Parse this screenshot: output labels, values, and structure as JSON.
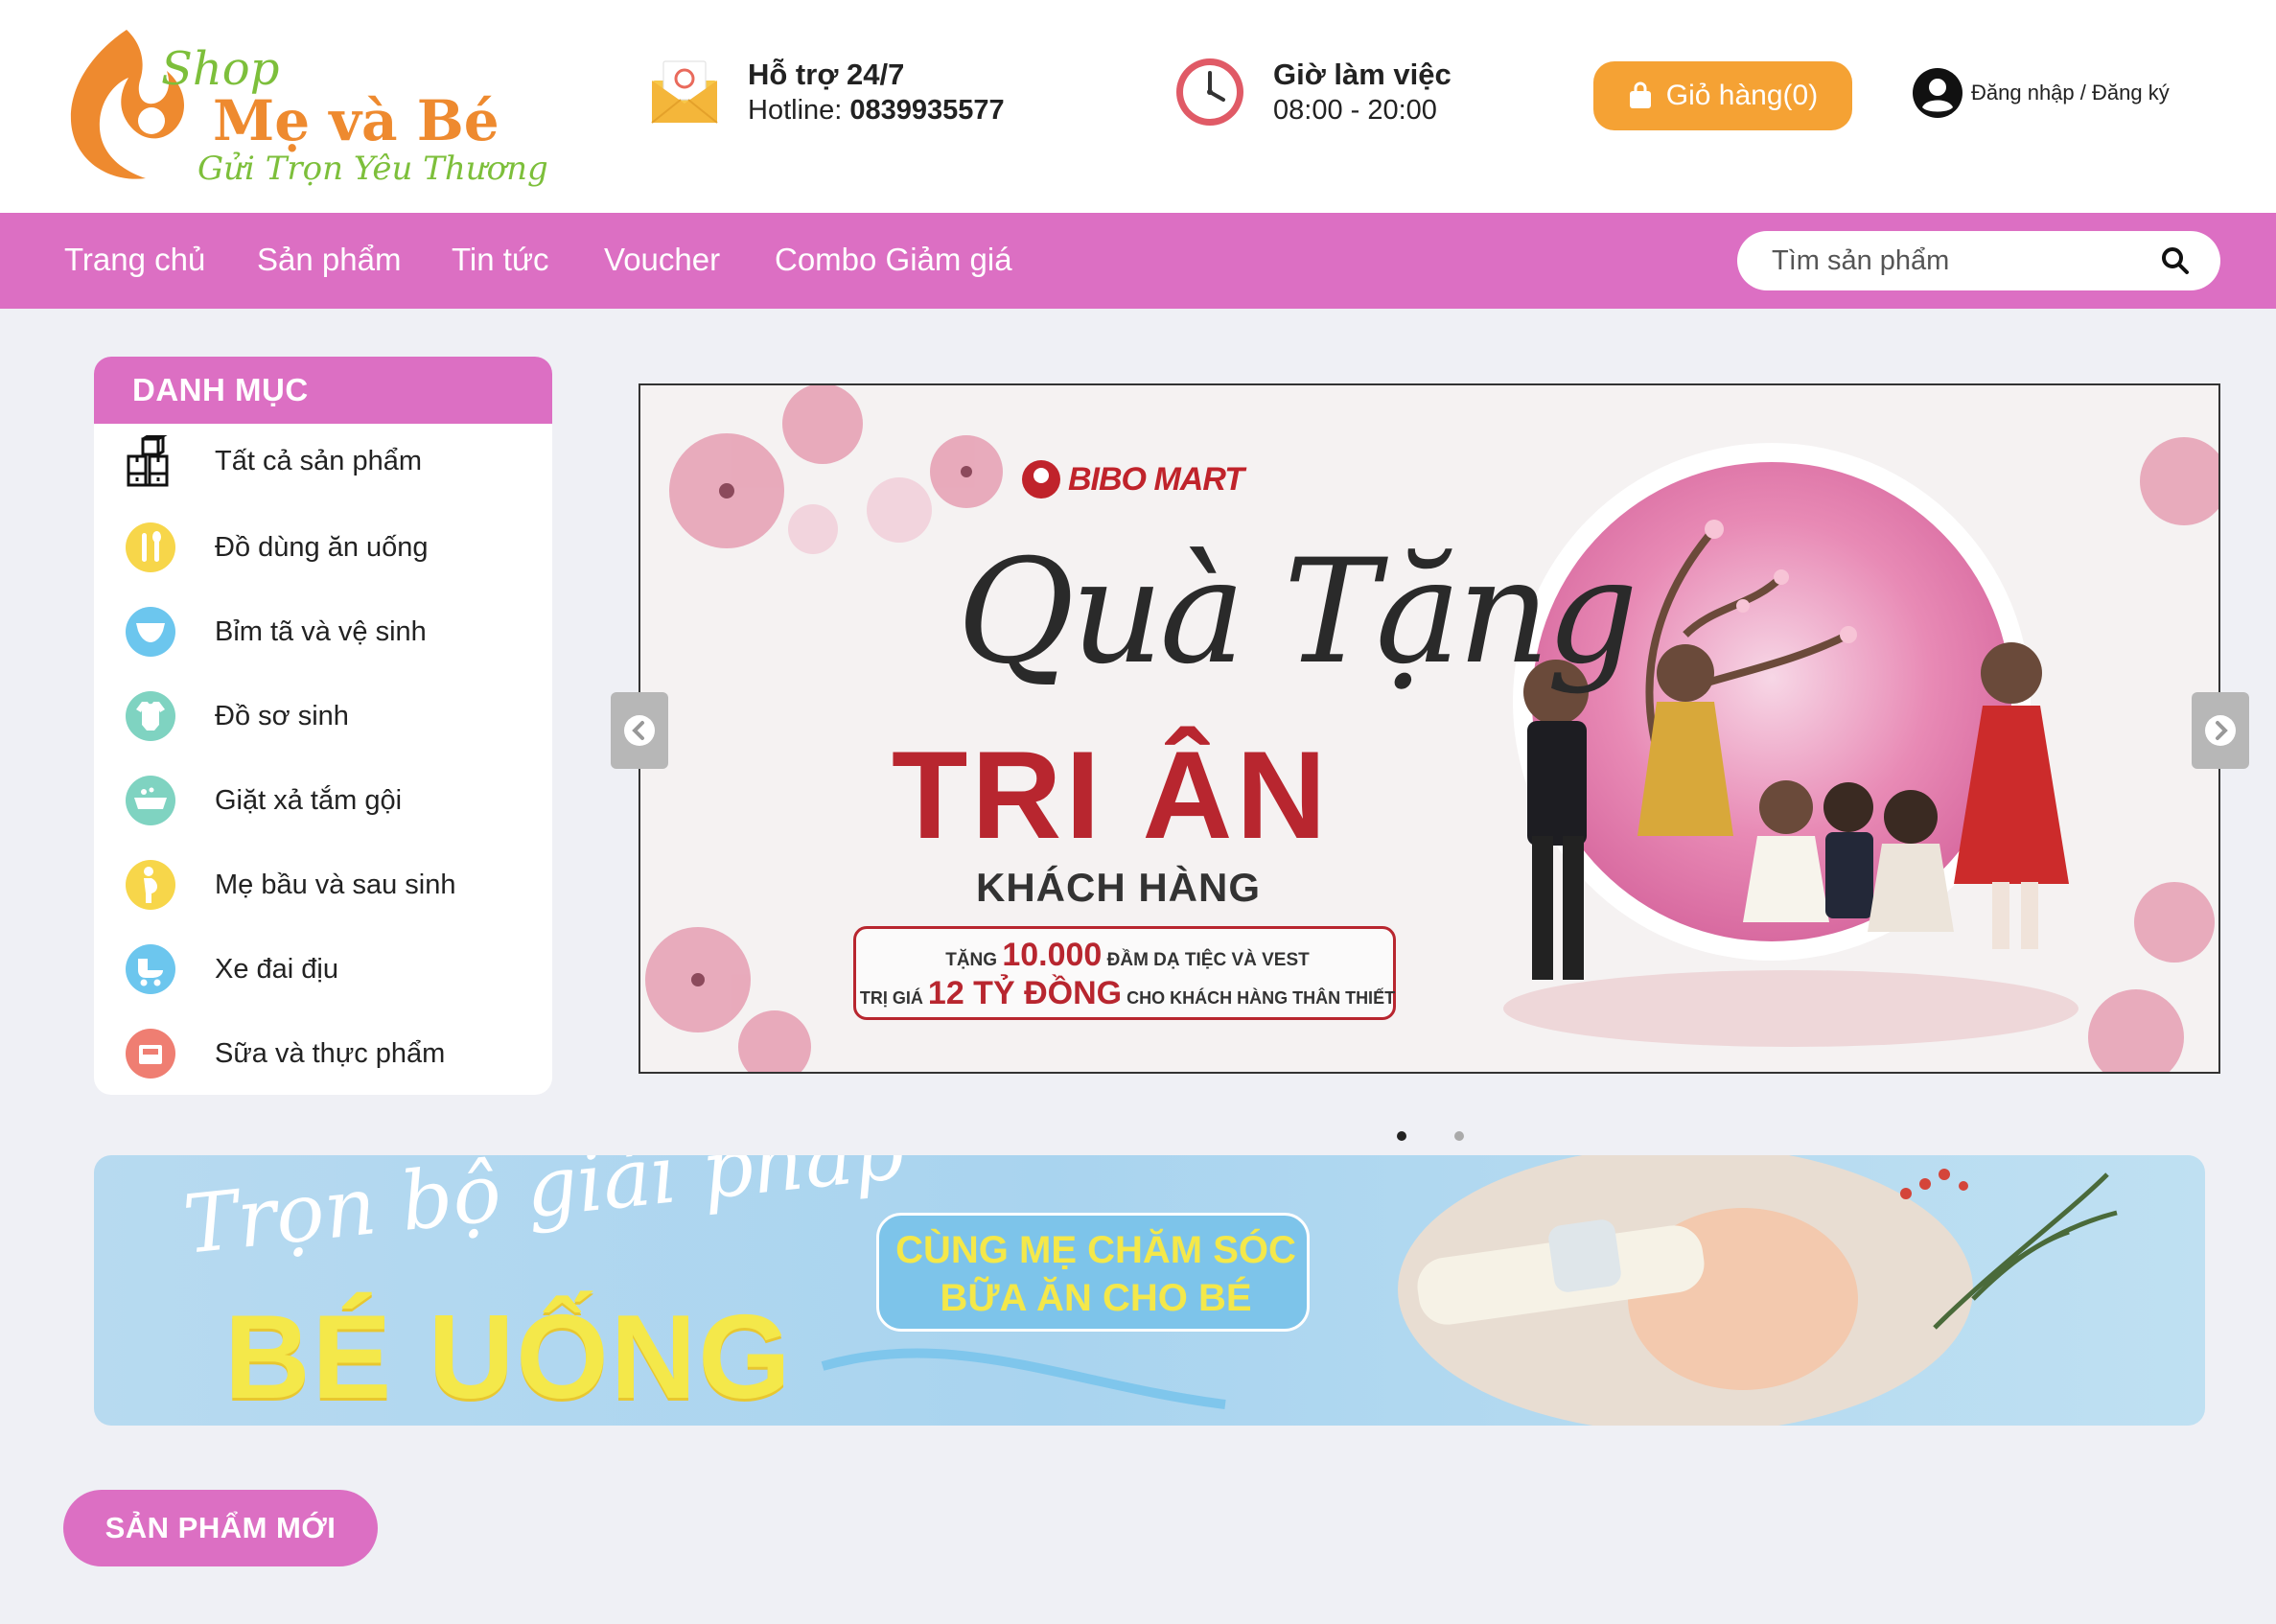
{
  "brand": {
    "shop": "Shop",
    "name": "Mẹ và Bé",
    "slogan": "Gửi Trọn Yêu Thương",
    "color_primary": "#dc6fc3",
    "color_accent": "#f5a234",
    "color_logo": "#ee8a2f"
  },
  "header": {
    "support_title": "Hỗ trợ 24/7",
    "hotline_label": "Hotline: ",
    "hotline_number": "0839935577",
    "hours_title": "Giờ làm việc",
    "hours_value": "08:00 - 20:00",
    "cart_label": "Giỏ hàng(0)",
    "account_label": "Đăng nhập / Đăng ký"
  },
  "nav": {
    "items": [
      "Trang chủ",
      "Sản phẩm",
      "Tin tức",
      "Voucher",
      "Combo Giảm giá"
    ],
    "search_placeholder": "Tìm sản phẩm"
  },
  "sidebar": {
    "title": "DANH MỤC",
    "categories": [
      {
        "label": "Tất cả sản phẩm",
        "icon": "boxes-icon"
      },
      {
        "label": "Đồ dùng ăn uống",
        "icon": "cutlery-icon"
      },
      {
        "label": "Bỉm tã và vệ sinh",
        "icon": "diaper-icon"
      },
      {
        "label": "Đồ sơ sinh",
        "icon": "onesie-icon"
      },
      {
        "label": "Giặt xả tắm gội",
        "icon": "bathtub-icon"
      },
      {
        "label": "Mẹ bầu và sau sinh",
        "icon": "pregnant-icon"
      },
      {
        "label": "Xe đai địu",
        "icon": "stroller-icon"
      },
      {
        "label": "Sữa và thực phẩm",
        "icon": "milk-box-icon"
      }
    ]
  },
  "hero": {
    "brand": "BIBO MART",
    "script": "Quà Tặng",
    "headline": "TRI ÂN",
    "subheadline": "KHÁCH HÀNG",
    "promo_l1_pre": "TẶNG ",
    "promo_l1_big": "10.000",
    "promo_l1_post": " ĐẦM DẠ TIỆC VÀ VEST",
    "promo_l2_pre": "TRỊ GIÁ ",
    "promo_l2_big": "12 TỶ ĐỒNG",
    "promo_l2_post": " CHO KHÁCH HÀNG THÂN THIẾT",
    "slides": 2,
    "active_slide": 1
  },
  "banner2": {
    "script": "Trọn bộ giải pháp",
    "headline": "BÉ UỐNG",
    "box_l1": "CÙNG MẸ CHĂM SÓC",
    "box_l2": "BỮA ĂN CHO BÉ"
  },
  "section": {
    "new_products": "SẢN PHẨM MỚI"
  }
}
